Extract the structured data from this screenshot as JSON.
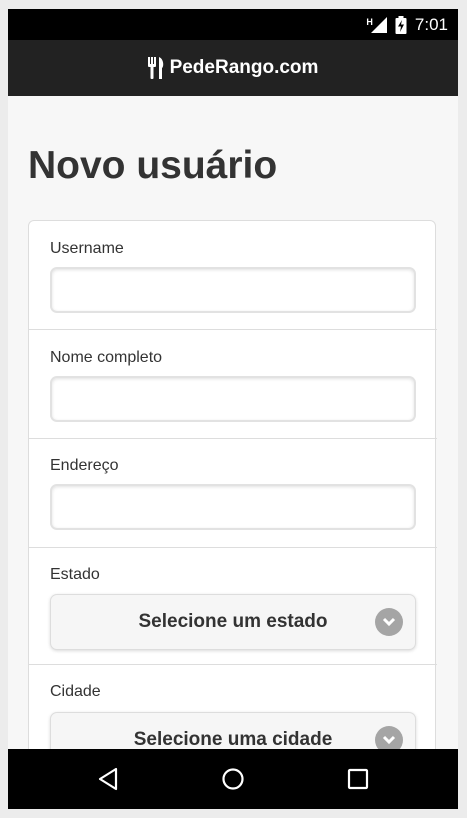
{
  "status_bar": {
    "network_label": "H",
    "time": "7:01"
  },
  "app_bar": {
    "title": "PedeRango.com",
    "logo_icon": "fork-knife-icon"
  },
  "page": {
    "title": "Novo usuário"
  },
  "form": {
    "username": {
      "label": "Username",
      "value": "",
      "placeholder": ""
    },
    "full_name": {
      "label": "Nome completo",
      "value": "",
      "placeholder": ""
    },
    "address": {
      "label": "Endereço",
      "value": "",
      "placeholder": ""
    },
    "state": {
      "label": "Estado",
      "selected": "Selecione um estado"
    },
    "city": {
      "label": "Cidade",
      "selected": "Selecione uma cidade"
    }
  },
  "nav_bar": {
    "back_icon": "back-triangle-icon",
    "home_icon": "home-circle-icon",
    "recents_icon": "recents-square-icon"
  },
  "colors": {
    "status_bar": "#000000",
    "app_bar": "#222222",
    "page_background": "#f7f7f7",
    "text": "#333333",
    "chevron_badge": "#a5a5a5"
  }
}
